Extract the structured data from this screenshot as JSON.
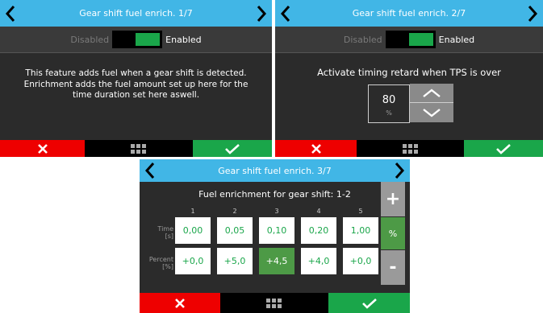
{
  "panels": [
    {
      "title": "Gear shift fuel enrich. 1/7",
      "toggle": {
        "off_label": "Disabled",
        "on_label": "Enabled",
        "state": "on"
      },
      "description": "This feature adds fuel when a gear shift is detected. Enrichment adds the fuel amount set up here for the time duration set here aswell."
    },
    {
      "title": "Gear shift fuel enrich. 2/7",
      "toggle": {
        "off_label": "Disabled",
        "on_label": "Enabled",
        "state": "on"
      },
      "heading": "Activate timing retard when TPS is over",
      "value": "80",
      "unit": "%"
    },
    {
      "title": "Gear shift fuel enrich. 3/7",
      "heading": "Fuel enrichment for gear shift: 1-2",
      "columns": [
        "1",
        "2",
        "3",
        "4",
        "5"
      ],
      "rows": [
        {
          "label": "Time",
          "unit": "[s]",
          "values": [
            "0,00",
            "0,05",
            "0,10",
            "0,20",
            "1,00"
          ]
        },
        {
          "label": "Percent",
          "unit": "[%]",
          "values": [
            "+0,0",
            "+5,0",
            "+4,5",
            "+4,0",
            "+0,0"
          ]
        }
      ],
      "selected_cell": {
        "row": 1,
        "col": 2
      },
      "side_buttons": {
        "plus": "+",
        "unit": "%",
        "minus": "-"
      },
      "scroll_position": 0.5
    }
  ],
  "colors": {
    "header": "#41b6e6",
    "accent_green": "#1aa64a",
    "selected_green": "#4d9a46",
    "cancel_red": "#ee0000"
  },
  "icons": {
    "prev": "chevron-left-icon",
    "next": "chevron-right-icon",
    "cancel": "x-icon",
    "menu": "grid-icon",
    "confirm": "check-icon"
  }
}
